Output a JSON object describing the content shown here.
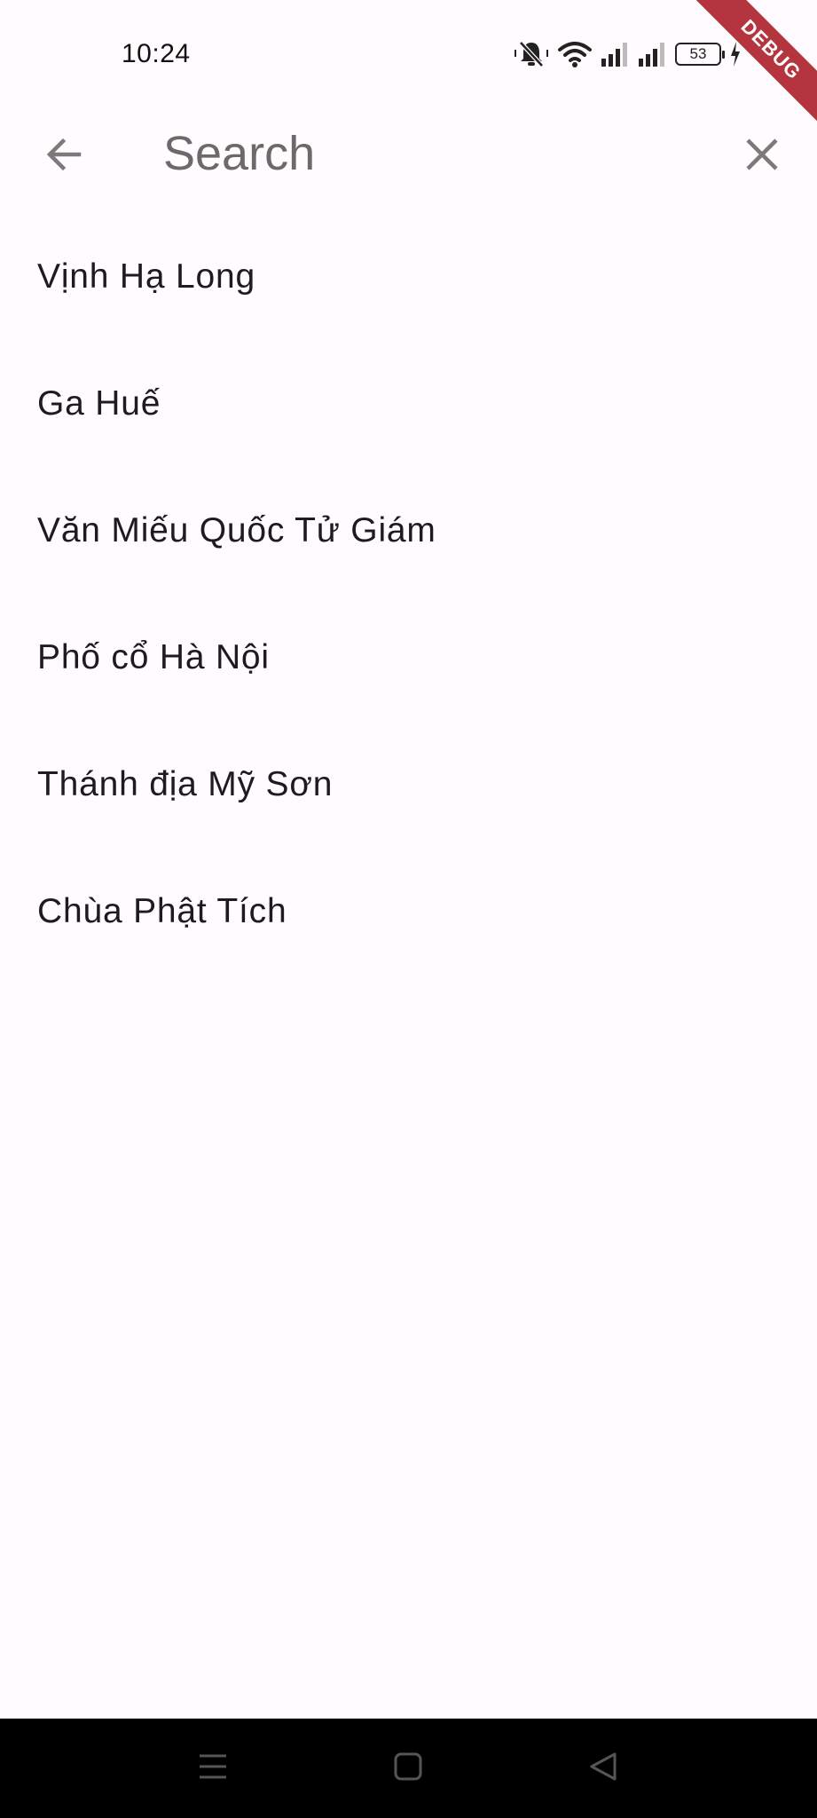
{
  "status_bar": {
    "time": "10:24",
    "battery_level": "53",
    "icons": [
      "mute-icon",
      "wifi-icon",
      "signal-icon",
      "signal-icon",
      "battery-icon",
      "charging-icon"
    ]
  },
  "debug_banner": {
    "label": "DEBUG",
    "color": "#b5353e"
  },
  "app_bar": {
    "back_icon": "arrow-left-icon",
    "search": {
      "placeholder": "Search",
      "value": ""
    },
    "close_icon": "close-icon"
  },
  "results": [
    {
      "label": "Vịnh Hạ Long"
    },
    {
      "label": "Ga Huế"
    },
    {
      "label": "Văn Miếu Quốc Tử Giám"
    },
    {
      "label": "Phố cổ Hà Nội"
    },
    {
      "label": "Thánh địa Mỹ Sơn"
    },
    {
      "label": "Chùa Phật Tích"
    }
  ],
  "nav_bar": {
    "buttons": [
      "menu-icon",
      "home-icon",
      "back-icon"
    ]
  },
  "colors": {
    "background": "#fffbfe",
    "text": "#1c1b1f",
    "icon": "#7a7a7a",
    "nav_background": "#000000"
  }
}
